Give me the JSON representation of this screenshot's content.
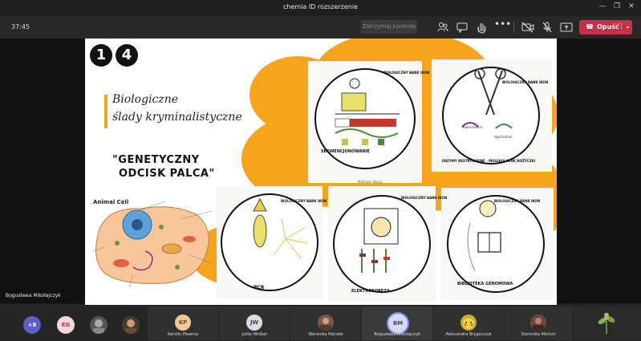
{
  "window": {
    "title": "chemia ID rozszerzenie"
  },
  "toolbar": {
    "timer": "37:45",
    "stop_control_label": "Zatrzymaj kontrolę",
    "leave_label": "Opuść",
    "leave_color": "#c4314b"
  },
  "slide": {
    "badge_1": "1",
    "badge_2": "4",
    "heading_line1": "Biologiczne",
    "heading_line2": "ślady kryminalistyczne",
    "subtitle_line1": "\"GENETYCZNY",
    "subtitle_line2": "ODCISK PALCA\"",
    "cell_title": "Animal Cell",
    "accent_color": "#f7a41d",
    "cards": [
      {
        "label": "SEKWENCJONOWANIE",
        "top_label": "BIOLOGICZNY BANK IKON"
      },
      {
        "label": "ENZYMY RESTRYKCYJNE - MOLEKULARNE NOŻYCZKI",
        "top_label": "BIOLOGICZNY BANK IKON",
        "extra1": "lepkie końce",
        "extra2": "tępe końce"
      },
      {
        "label": "PCR",
        "top_label": "BIOLOGICZNY BANK IKON"
      },
      {
        "label": "ELEKTROFOREZA",
        "top_label": "BIOLOGICZNY BANK IKON",
        "corner_note": "Mathaen Marija"
      },
      {
        "label": "BIBLIOTEKA GENOMOWA",
        "top_label": "BIOLOGICZNY BANK IKON"
      }
    ]
  },
  "presenter_name": "Bogusława Mikołajczyk",
  "participants": {
    "overflow": "+8",
    "eg_initials": "EG",
    "tiles": [
      {
        "initials": "KP",
        "name": "Kerstin Plewnia",
        "color": "#f0c89a",
        "text_color": "#7a4a1a"
      },
      {
        "initials": "JW",
        "name": "Julita Wróbel",
        "color": "#d8dde8",
        "text_color": "#444"
      },
      {
        "initials": "",
        "name": "Weronika Patrzek",
        "color": "#7a5a4a",
        "text_color": "#fff"
      },
      {
        "initials": "BM",
        "name": "Bogusława Mikołajczyk",
        "color": "#d5dbee",
        "text_color": "#3a4470"
      },
      {
        "initials": "",
        "name": "Aleksandra Brygarczyk",
        "color": "#c9a93a",
        "text_color": "#fff"
      },
      {
        "initials": "",
        "name": "Dominika Michoń",
        "color": "#6a4a3a",
        "text_color": "#fff"
      }
    ]
  }
}
